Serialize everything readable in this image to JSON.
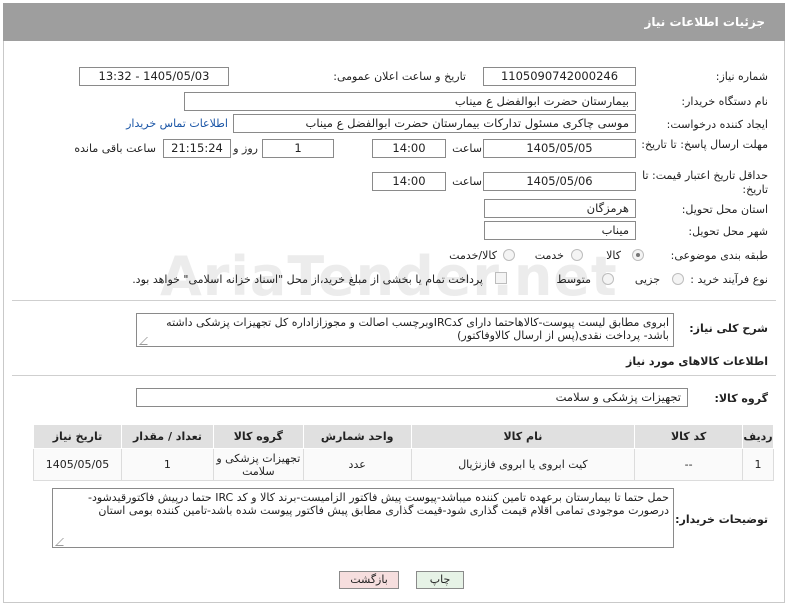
{
  "header": {
    "title": "جزئیات اطلاعات نیاز"
  },
  "form": {
    "need_number_label": "شماره نیاز:",
    "need_number": "1105090742000246",
    "announce_label": "تاریخ و ساعت اعلان عمومی:",
    "announce_value": "1405/05/03 - 13:32",
    "buyer_label": "نام دستگاه خریدار:",
    "buyer_value": "بیمارستان حضرت ابوالفضل ع  میناب",
    "creator_label": "ایجاد کننده درخواست:",
    "creator_value": "موسی چاکری مسئول تدارکات بیمارستان حضرت ابوالفضل ع  میناب",
    "contact_link": "اطلاعات تماس خریدار",
    "reply_label": "مهلت ارسال پاسخ: تا تاریخ:",
    "reply_date": "1405/05/05",
    "time_label": "ساعت",
    "reply_time": "14:00",
    "days_value": "1",
    "days_label": "روز و",
    "remaining_value": "21:15:24",
    "remaining_label": "ساعت باقی مانده",
    "validity_label": "حداقل تاریخ اعتبار قیمت: تا تاریخ:",
    "validity_date": "1405/05/06",
    "validity_time": "14:00",
    "province_label": "استان محل تحویل:",
    "province_value": "هرمزگان",
    "city_label": "شهر محل تحویل:",
    "city_value": "میناب",
    "category_label": "طبقه بندی موضوعی:",
    "category_options": [
      "کالا",
      "خدمت",
      "کالا/خدمت"
    ],
    "process_label": "نوع فرآیند خرید :",
    "process_options": [
      "جزیی",
      "متوسط"
    ],
    "payment_note": "پرداخت تمام یا بخشی از مبلغ خرید،از محل \"اسناد خزانه اسلامی\" خواهد بود."
  },
  "description": {
    "label": "شرح کلی نیاز:",
    "text": "ابروی مطابق لیست پیوست-کالاهاحتما دارای کدIRCوبرچسب اصالت و مجوزازاداره کل تجهیزات پزشکی داشته باشد- پرداخت نقدی(پس از ارسال کالاوفاکتور)"
  },
  "goods": {
    "section_title": "اطلاعات کالاهای مورد نیاز",
    "group_label": "گروه کالا:",
    "group_value": "تجهیزات پزشکی و سلامت",
    "columns": [
      "ردیف",
      "کد کالا",
      "نام کالا",
      "واحد شمارش",
      "گروه کالا",
      "تعداد / مقدار",
      "تاریخ نیاز"
    ],
    "rows": [
      [
        "1",
        "--",
        "کیت ابروی یا ابروی فازنژیال",
        "عدد",
        "تجهیزات پزشکی و سلامت",
        "1",
        "1405/05/05"
      ]
    ]
  },
  "buyer_notes": {
    "label": "توضیحات خریدار:",
    "text": "حمل حتما تا بیمارستان برعهده تامین کننده میباشد-پیوست پیش فاکتور الزامیست-برند کالا و کد IRC حتما درپیش فاکتورقیدشود-درصورت موجودی تمامی اقلام قیمت گذاری شود-قیمت گذاری مطابق پیش فاکتور پیوست شده باشد-تامین کننده بومی استان"
  },
  "buttons": {
    "print": "چاپ",
    "back": "بازگشت"
  },
  "watermark": "AriaTender.net"
}
